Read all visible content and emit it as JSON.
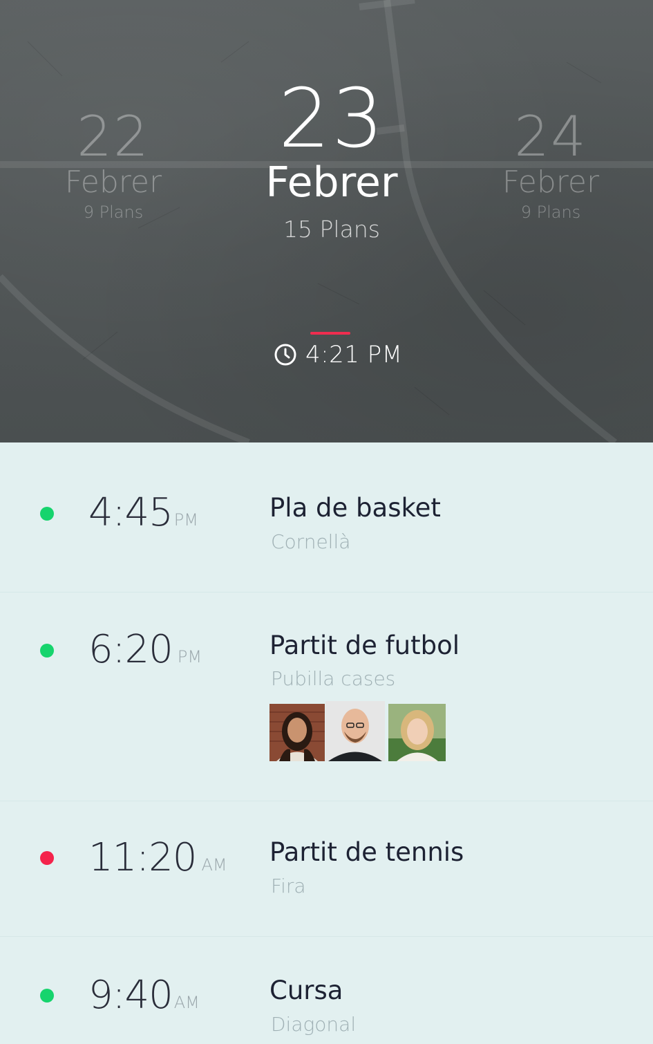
{
  "header": {
    "days": {
      "prev": {
        "num": "22",
        "month": "Febrer",
        "plans": "9 Plans"
      },
      "current": {
        "num": "23",
        "month": "Febrer",
        "plans": "15 Plans"
      },
      "next": {
        "num": "24",
        "month": "Febrer",
        "plans": "9 Plans"
      }
    },
    "current_time": "4:21 PM",
    "accent_color": "#ef2d4f"
  },
  "events": [
    {
      "time": "4:45",
      "ampm": "PM",
      "title": "Pla de basket",
      "place": "Cornellà",
      "status": "green"
    },
    {
      "time": "6:20",
      "ampm": "PM",
      "title": "Partit de futbol",
      "place": "Pubilla cases",
      "status": "green",
      "participants": 3
    },
    {
      "time": "11:20",
      "ampm": "AM",
      "title": "Partit de tennis",
      "place": "Fira",
      "status": "red"
    },
    {
      "time": "9:40",
      "ampm": "AM",
      "title": "Cursa",
      "place": "Diagonal",
      "status": "green"
    }
  ],
  "colors": {
    "status_green": "#16d46d",
    "status_red": "#f4234b",
    "list_bg": "#e2f0f0"
  }
}
